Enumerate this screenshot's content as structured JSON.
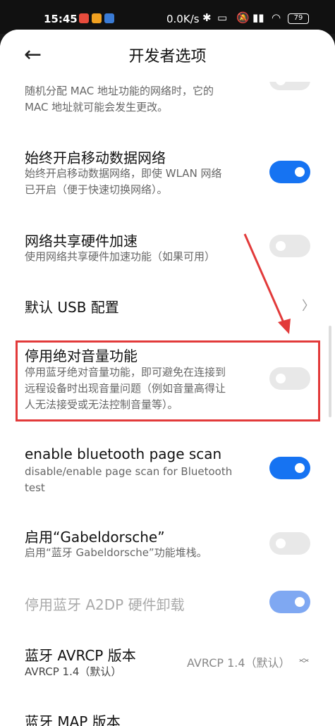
{
  "status_bar": {
    "time": "15:45",
    "speed": "0.0K/s",
    "battery": "79",
    "icons": [
      "bluetooth-icon",
      "vibrate-icon",
      "mute-icon",
      "hd-signal-icon",
      "wifi-icon"
    ]
  },
  "header": {
    "title": "开发者选项",
    "back_icon": "back-arrow-icon"
  },
  "items": [
    {
      "desc_line1": "随机分配 MAC 地址功能的网络时，它的",
      "desc_line2": "MAC 地址就可能会发生更改。",
      "toggle": "off"
    },
    {
      "title": "始终开启移动数据网络",
      "desc_line1": "始终开启移动数据网络，即使 WLAN 网络",
      "desc_line2": "已开启（便于快速切换网络）。",
      "toggle": "on"
    },
    {
      "title": "网络共享硬件加速",
      "desc_line1": "使用网络共享硬件加速功能（如果可用）",
      "toggle": "off"
    },
    {
      "title": "默认 USB 配置"
    },
    {
      "title": "停用绝对音量功能",
      "desc_line1": "停用蓝牙绝对音量功能，即可避免在连接到",
      "desc_line2": "远程设备时出现音量问题（例如音量高得让",
      "desc_line3": "人无法接受或无法控制音量等）。",
      "toggle": "off"
    },
    {
      "title": "enable bluetooth page scan",
      "desc_line1": "disable/enable page scan for Bluetooth",
      "desc_line2": "test",
      "toggle": "on"
    },
    {
      "title": "启用“Gabeldorsche”",
      "desc_line1": "启用“蓝牙 Gabeldorsche”功能堆栈。",
      "toggle": "off"
    },
    {
      "title": "停用蓝牙 A2DP 硬件卸载",
      "toggle": "on-disabled"
    },
    {
      "title": "蓝牙 AVRCP 版本",
      "desc_line1": "AVRCP 1.4（默认）",
      "value": "AVRCP 1.4（默认）"
    },
    {
      "title": "蓝牙 MAP 版本"
    }
  ],
  "colors": {
    "accent": "#1673f2",
    "annotation_red": "#e23a3a"
  }
}
